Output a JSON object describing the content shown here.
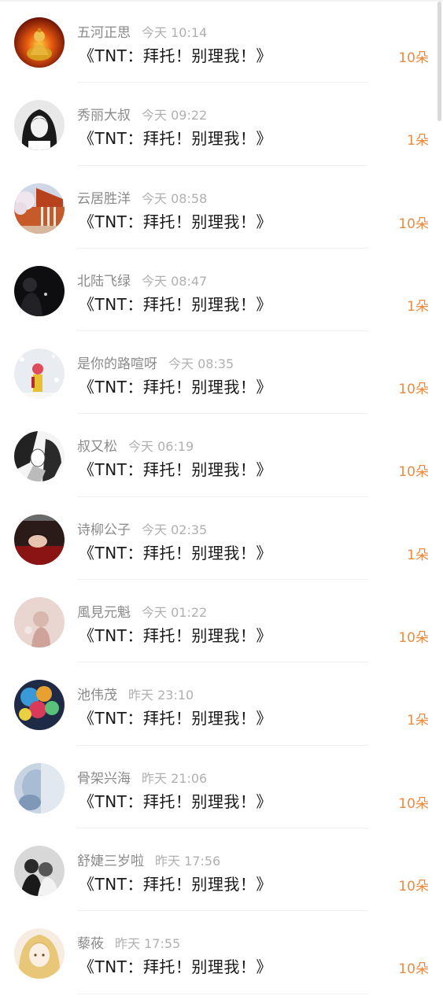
{
  "colors": {
    "accent": "#ee8a3e",
    "name": "#8a8a8a",
    "time": "#b0b0b0",
    "title": "#1a1a1a"
  },
  "items": [
    {
      "name": "五河正思",
      "time": "今天 10:14",
      "title": "《TNT：拜托！别理我！》",
      "amount": "10朵",
      "avatar": "buddha"
    },
    {
      "name": "秀丽大叔",
      "time": "今天 09:22",
      "title": "《TNT：拜托！别理我！》",
      "amount": "1朵",
      "avatar": "girl-bw"
    },
    {
      "name": "云居胜洋",
      "time": "今天 08:58",
      "title": "《TNT：拜托！别理我！》",
      "amount": "10朵",
      "avatar": "temple"
    },
    {
      "name": "北陆飞绿",
      "time": "今天 08:47",
      "title": "《TNT：拜托！别理我！》",
      "amount": "1朵",
      "avatar": "dark-silhouette"
    },
    {
      "name": "是你的路喧呀",
      "time": "今天 08:35",
      "title": "《TNT：拜托！别理我！》",
      "amount": "10朵",
      "avatar": "snow-girl"
    },
    {
      "name": "叔又松",
      "time": "今天 06:19",
      "title": "《TNT：拜托！别理我！》",
      "amount": "10朵",
      "avatar": "manga"
    },
    {
      "name": "诗柳公子",
      "time": "今天 02:35",
      "title": "《TNT：拜托！别理我！》",
      "amount": "1朵",
      "avatar": "lying-girl"
    },
    {
      "name": "風見元魁",
      "time": "今天 01:22",
      "title": "《TNT：拜托！别理我！》",
      "amount": "10朵",
      "avatar": "pink-girl"
    },
    {
      "name": "池伟茂",
      "time": "昨天 23:10",
      "title": "《TNT：拜托！别理我！》",
      "amount": "1朵",
      "avatar": "balloons"
    },
    {
      "name": "骨架兴海",
      "time": "昨天 21:06",
      "title": "《TNT：拜托！别理我！》",
      "amount": "10朵",
      "avatar": "blue-blur"
    },
    {
      "name": "舒婕三岁啦",
      "time": "昨天 17:56",
      "title": "《TNT：拜托！别理我！》",
      "amount": "10朵",
      "avatar": "couple-bw"
    },
    {
      "name": "藜莜",
      "time": "昨天 17:55",
      "title": "《TNT：拜托！别理我！》",
      "amount": "10朵",
      "avatar": "anime-blonde"
    }
  ]
}
